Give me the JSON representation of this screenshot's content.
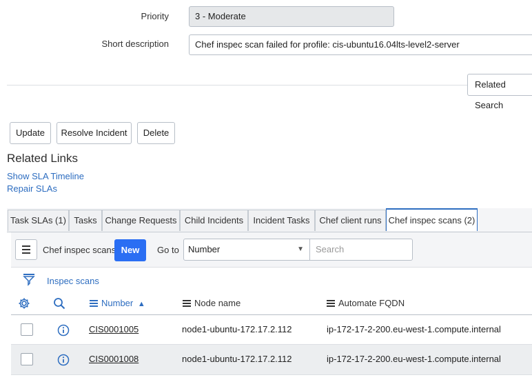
{
  "form": {
    "priority_label": "Priority",
    "priority_value": "3 - Moderate",
    "short_desc_label": "Short description",
    "short_desc_value": "Chef inspec scan failed for profile: cis-ubuntu16.04lts-level2-server",
    "related_search_label": "Related Search"
  },
  "actions": {
    "update": "Update",
    "resolve": "Resolve Incident",
    "delete": "Delete"
  },
  "related_links": {
    "title": "Related Links",
    "items": [
      "Show SLA Timeline",
      "Repair SLAs"
    ]
  },
  "tabs": [
    "Task SLAs (1)",
    "Tasks",
    "Change Requests",
    "Child Incidents",
    "Incident Tasks",
    "Chef client runs",
    "Chef inspec scans (2)"
  ],
  "list": {
    "title": "Chef inspec scans",
    "new_label": "New",
    "goto_label": "Go to",
    "goto_selected": "Number",
    "search_placeholder": "Search",
    "filter_label": "Inspec scans",
    "columns": [
      "Number",
      "Node name",
      "Automate FQDN"
    ],
    "sort_indicator": "▲",
    "rows": [
      {
        "number": "CIS0001005",
        "node": "node1-ubuntu-172.17.2.112",
        "fqdn": "ip-172-17-2-200.eu-west-1.compute.internal"
      },
      {
        "number": "CIS0001008",
        "node": "node1-ubuntu-172.17.2.112",
        "fqdn": "ip-172-17-2-200.eu-west-1.compute.internal"
      }
    ]
  },
  "colors": {
    "accent": "#2d6dc0",
    "new_button": "#2a6ef3"
  },
  "icons": {
    "settings": "gear-icon",
    "search": "search-icon",
    "filter": "filter-icon",
    "info": "info-icon",
    "menu": "hamburger-icon"
  }
}
